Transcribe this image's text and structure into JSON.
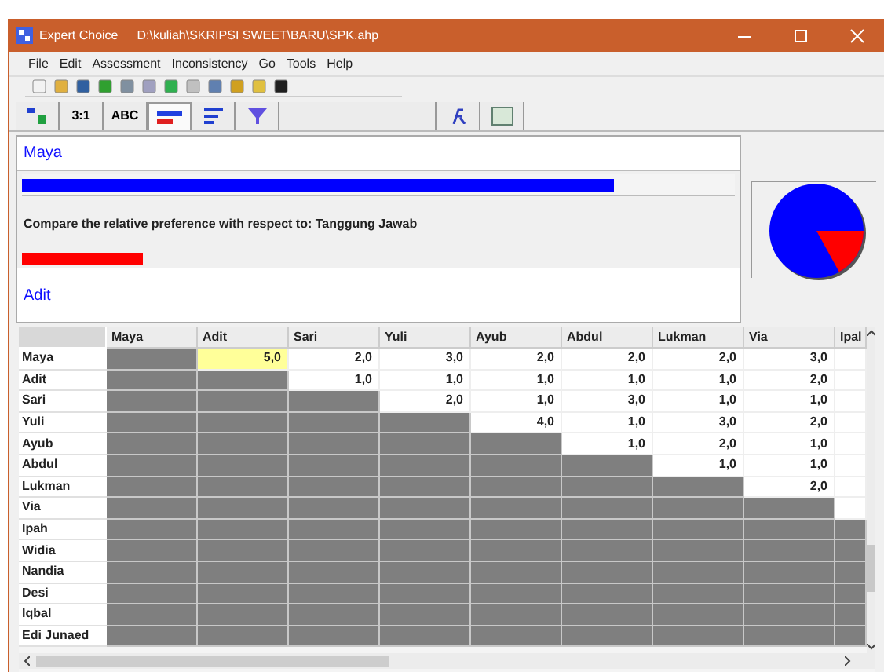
{
  "window": {
    "app_name": "Expert Choice",
    "title": "D:\\kuliah\\SKRIPSI SWEET\\BARU\\SPK.ahp"
  },
  "menu": [
    "File",
    "Edit",
    "Assessment",
    "Inconsistency",
    "Go",
    "Tools",
    "Help"
  ],
  "tabs": [
    {
      "kind": "tree",
      "selected": false
    },
    {
      "kind": "text",
      "label": "3:1",
      "selected": false
    },
    {
      "kind": "text",
      "label": "ABC",
      "selected": false
    },
    {
      "kind": "bars",
      "selected": true
    },
    {
      "kind": "lines",
      "selected": false
    },
    {
      "kind": "funnel",
      "selected": false
    },
    {
      "kind": "blank",
      "selected": false
    },
    {
      "kind": "fx",
      "selected": false
    },
    {
      "kind": "grid",
      "selected": false
    }
  ],
  "comparison": {
    "top_item": "Maya",
    "top_bar": {
      "level": 0.83
    },
    "prompt": "Compare the relative preference with respect to: Tanggung Jawab",
    "bottom_bar": {
      "level": 0.17
    },
    "bottom_item": "Adit"
  },
  "table": {
    "columns": [
      "Maya",
      "Adit",
      "Sari",
      "Yuli",
      "Ayub",
      "Abdul",
      "Lukman",
      "Via",
      "Ipal"
    ],
    "rows": [
      {
        "name": "Maya",
        "cells": [
          {
            "value": "5,0",
            "selected": true
          },
          {
            "value": "2,0",
            "selected": false
          },
          {
            "value": "3,0",
            "selected": false
          },
          {
            "value": "2,0",
            "selected": false
          },
          {
            "value": "2,0",
            "selected": false
          },
          {
            "value": "2,0",
            "selected": false
          },
          {
            "value": "3,0",
            "selected": false
          }
        ]
      },
      {
        "name": "Adit",
        "cells": [
          {
            "value": "1,0",
            "selected": false
          },
          {
            "value": "1,0",
            "selected": false
          },
          {
            "value": "1,0",
            "selected": false
          },
          {
            "value": "1,0",
            "selected": false
          },
          {
            "value": "1,0",
            "selected": false
          },
          {
            "value": "2,0",
            "selected": false
          }
        ]
      },
      {
        "name": "Sari",
        "cells": [
          {
            "value": "2,0",
            "selected": false
          },
          {
            "value": "1,0",
            "selected": false
          },
          {
            "value": "3,0",
            "selected": false
          },
          {
            "value": "1,0",
            "selected": false
          },
          {
            "value": "1,0",
            "selected": false
          }
        ]
      },
      {
        "name": "Yuli",
        "cells": [
          {
            "value": "4,0",
            "selected": false
          },
          {
            "value": "1,0",
            "selected": false
          },
          {
            "value": "3,0",
            "selected": false
          },
          {
            "value": "2,0",
            "selected": false
          }
        ]
      },
      {
        "name": "Ayub",
        "cells": [
          {
            "value": "1,0",
            "selected": false
          },
          {
            "value": "2,0",
            "selected": false
          },
          {
            "value": "1,0",
            "selected": false
          }
        ]
      },
      {
        "name": "Abdul",
        "cells": [
          {
            "value": "1,0",
            "selected": false
          },
          {
            "value": "1,0",
            "selected": false
          }
        ]
      },
      {
        "name": "Lukman",
        "cells": [
          {
            "value": "2,0",
            "selected": false
          }
        ]
      },
      {
        "name": "Via",
        "cells": []
      },
      {
        "name": "Ipah",
        "cells": []
      },
      {
        "name": "Widia",
        "cells": []
      },
      {
        "name": "Nandia",
        "cells": []
      },
      {
        "name": "Desi",
        "cells": []
      },
      {
        "name": "Iqbal",
        "cells": []
      },
      {
        "name": "Edi Junaed",
        "cells": []
      }
    ]
  }
}
